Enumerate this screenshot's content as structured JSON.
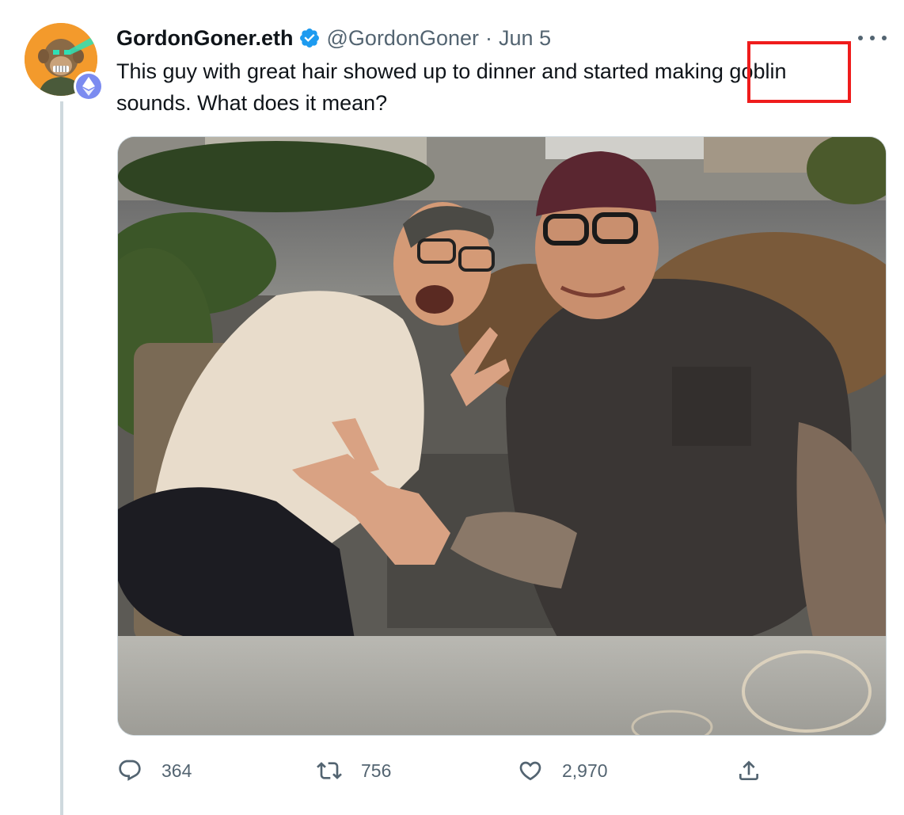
{
  "tweet": {
    "display_name": "GordonGoner.eth",
    "handle": "@GordonGoner",
    "separator": "·",
    "date": "Jun 5",
    "text": "This guy with great hair showed up to dinner and started making goblin sounds. What does it mean?",
    "avatar_badge": "ethereum-icon",
    "verified": true
  },
  "photo": {
    "subject": "Two men posing at an outdoor restaurant table at night, one laughing with a goblin face, one giving a peace sign"
  },
  "actions": {
    "reply_count": "364",
    "retweet_count": "756",
    "like_count": "2,970",
    "icons": [
      "reply-icon",
      "retweet-icon",
      "like-icon",
      "share-icon"
    ]
  },
  "annotation": {
    "color": "#ef1c1c",
    "target": "goblin"
  },
  "colors": {
    "text": "#0f1419",
    "secondary": "#536471",
    "verified": "#1d9bf0",
    "thread_line": "#cfd9de"
  }
}
